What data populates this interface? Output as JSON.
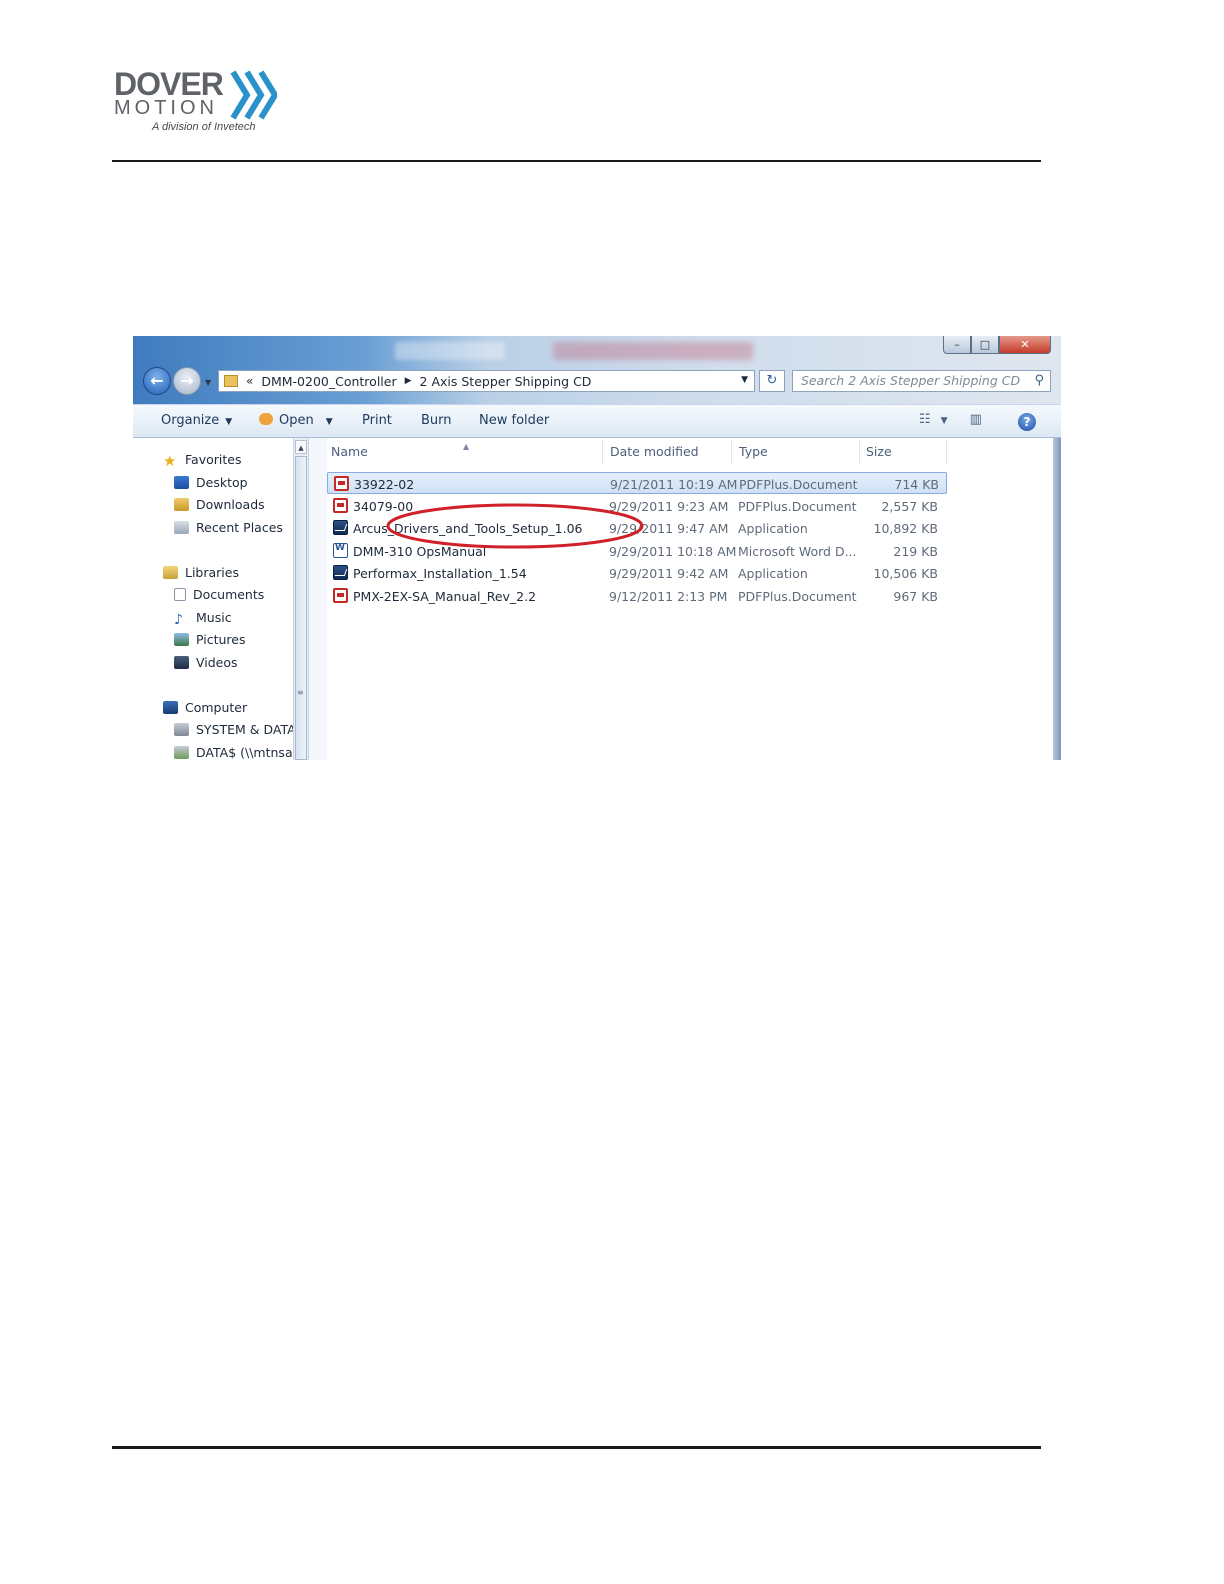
{
  "header": {
    "logo_word1": "DOVER",
    "logo_word2": "MOTION",
    "logo_tagline": "A division of Invetech",
    "logo_colors": {
      "text": "#5f6267",
      "chevrons": "#2a91c9"
    }
  },
  "explorer": {
    "window_buttons": {
      "minimize": "–",
      "maximize": "□",
      "close": "✕"
    },
    "address": {
      "overflow": "«",
      "crumbs": [
        "DMM-0200_Controller",
        "2 Axis Stepper Shipping CD"
      ]
    },
    "search_placeholder": "Search 2 Axis Stepper Shipping CD",
    "toolbar": {
      "organize": "Organize",
      "open": "Open",
      "print": "Print",
      "burn": "Burn",
      "new_folder": "New folder"
    },
    "nav": {
      "favorites": "Favorites",
      "desktop": "Desktop",
      "downloads": "Downloads",
      "recent_places": "Recent Places",
      "libraries": "Libraries",
      "documents": "Documents",
      "music": "Music",
      "pictures": "Pictures",
      "videos": "Videos",
      "computer": "Computer",
      "drive1": "SYSTEM & DATA",
      "drive2": "DATA$ (\\\\mtnsal"
    },
    "columns": {
      "name": "Name",
      "date": "Date modified",
      "type": "Type",
      "size": "Size"
    },
    "files": [
      {
        "name": "33922-02",
        "date": "9/21/2011 10:19 AM",
        "type": "PDFPlus.Document",
        "size": "714 KB",
        "icon": "pdf-icon"
      },
      {
        "name": "34079-00",
        "date": "9/29/2011 9:23 AM",
        "type": "PDFPlus.Document",
        "size": "2,557 KB",
        "icon": "pdf-icon"
      },
      {
        "name": "Arcus_Drivers_and_Tools_Setup_1.06",
        "date": "9/29/2011 9:47 AM",
        "type": "Application",
        "size": "10,892 KB",
        "icon": "application-icon"
      },
      {
        "name": "DMM-310 OpsManual",
        "date": "9/29/2011 10:18 AM",
        "type": "Microsoft Word D...",
        "size": "219 KB",
        "icon": "word-document-icon"
      },
      {
        "name": "Performax_Installation_1.54",
        "date": "9/29/2011 9:42 AM",
        "type": "Application",
        "size": "10,506 KB",
        "icon": "application-icon"
      },
      {
        "name": "PMX-2EX-SA_Manual_Rev_2.2",
        "date": "9/12/2011 2:13 PM",
        "type": "PDFPlus.Document",
        "size": "967 KB",
        "icon": "pdf-icon"
      }
    ],
    "highlight_color": "#d0202a"
  }
}
